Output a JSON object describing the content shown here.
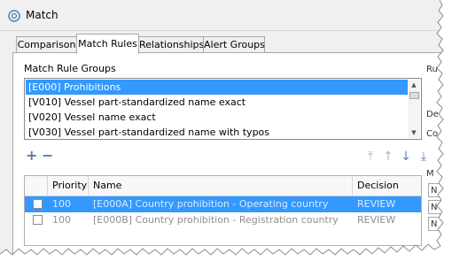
{
  "window": {
    "title": "Match"
  },
  "tabs": [
    {
      "label": "Comparison"
    },
    {
      "label": "Match Rules",
      "active": true
    },
    {
      "label": "Relationships"
    },
    {
      "label": "Alert Groups"
    }
  ],
  "groups": {
    "label": "Match Rule Groups",
    "items": [
      {
        "label": "[E000] Prohibitions",
        "selected": true
      },
      {
        "label": "[V010] Vessel part-standardized name exact"
      },
      {
        "label": "[V020] Vessel name exact"
      },
      {
        "label": "[V030] Vessel part-standardized name with typos"
      }
    ]
  },
  "toolbar": {
    "add": "+",
    "remove": "−"
  },
  "order_buttons": {
    "top": "⤒",
    "up": "↑",
    "down": "↓",
    "bottom": "⤓"
  },
  "rules_table": {
    "columns": [
      "Priority",
      "Name",
      "Decision"
    ],
    "rows": [
      {
        "priority": "100",
        "name": "[E000A] Country prohibition - Operating country",
        "decision": "REVIEW",
        "selected": true
      },
      {
        "priority": "100",
        "name": "[E000B] Country prohibition - Registration country",
        "decision": "REVIEW"
      }
    ]
  },
  "side_fragments": {
    "r1": "Ru",
    "d1": "De",
    "c1": "Co",
    "m1": "M",
    "box1": "N",
    "box2": "N",
    "box3": "N"
  },
  "colors": {
    "selection": "#3399ff",
    "accent_icon": "#5a86b8"
  }
}
